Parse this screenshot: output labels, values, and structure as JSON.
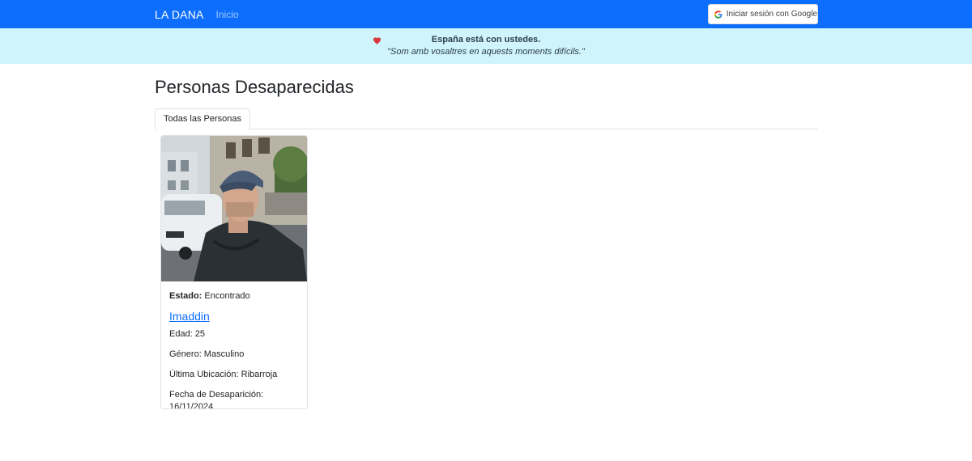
{
  "navbar": {
    "brand": "LA DANA",
    "nav_link": "Inicio",
    "login_label": "Iniciar sesión con Google",
    "accent_color": "#0d6efd"
  },
  "alert": {
    "icon": "heart-icon",
    "line1": "España está con ustedes.",
    "line2": "\"Som amb vosaltres en aquests moments difícils.\"",
    "background_color": "#cff4fc"
  },
  "main": {
    "title": "Personas Desaparecidas",
    "tabs": [
      {
        "label": "Todas las Personas",
        "active": true
      }
    ]
  },
  "cards": [
    {
      "status_label": "Estado:",
      "status_value": "Encontrado",
      "name": "Imaddin",
      "age": "Edad: 25",
      "gender": "Género: Masculino",
      "location": "Última Ubicación: Ribarroja",
      "date": "Fecha de Desaparición: 16/11/2024"
    }
  ]
}
